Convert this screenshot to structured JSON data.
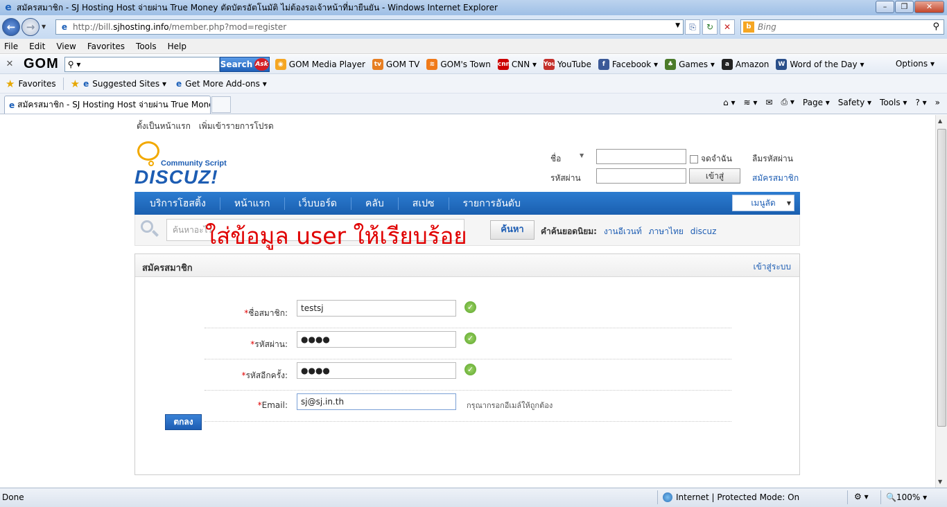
{
  "window": {
    "title": "สมัครสมาชิก - SJ Hosting Host จ่ายผ่าน True Money ตัดบัตรอัตโนมัติ ไม่ต้องรอเจ้าหน้าที่มายืนยัน - Windows Internet Explorer",
    "minimize": "–",
    "maximize": "❐",
    "close": "✕"
  },
  "address": {
    "url_prefix": "http://bill.",
    "url_domain": "sjhosting.info",
    "url_path": "/member.php?mod=register",
    "search_placeholder": "Bing"
  },
  "menu": [
    "File",
    "Edit",
    "View",
    "Favorites",
    "Tools",
    "Help"
  ],
  "gom_toolbar": {
    "logo": "GOM",
    "search_button": "Search",
    "ask_badge": "Ask",
    "links": [
      {
        "label": "GOM Media Player",
        "icon": "gom-player-icon",
        "color": "#f5a623",
        "glyph": "◉"
      },
      {
        "label": "GOM TV",
        "icon": "gomtv-icon",
        "color": "#e67e22",
        "glyph": "tv"
      },
      {
        "label": "GOM's Town",
        "icon": "rss-icon",
        "color": "#f07a1a",
        "glyph": "≋"
      },
      {
        "label": "CNN ▾",
        "icon": "cnn-icon",
        "color": "#cc0000",
        "glyph": "cnn"
      },
      {
        "label": "YouTube",
        "icon": "youtube-icon",
        "color": "#c4302b",
        "glyph": "You"
      },
      {
        "label": "Facebook ▾",
        "icon": "facebook-icon",
        "color": "#3b5998",
        "glyph": "f"
      },
      {
        "label": "Games ▾",
        "icon": "games-icon",
        "color": "#4a7a2a",
        "glyph": "♣"
      },
      {
        "label": "Amazon",
        "icon": "amazon-icon",
        "color": "#222222",
        "glyph": "a"
      },
      {
        "label": "Word of the Day ▾",
        "icon": "dictionary-icon",
        "color": "#2a4f8a",
        "glyph": "W"
      }
    ],
    "options": "Options ▾"
  },
  "favorites_bar": {
    "favorites": "Favorites",
    "suggested": "Suggested Sites ▾",
    "addons": "Get More Add-ons ▾"
  },
  "tab": {
    "title": "สมัครสมาชิก - SJ Hosting Host จ่ายผ่าน True Money..."
  },
  "command_bar": {
    "page": "Page ▾",
    "safety": "Safety ▾",
    "tools": "Tools ▾"
  },
  "site": {
    "top_links": [
      "ตั้งเป็นหน้าแรก",
      "เพิ่มเข้ารายการโปรด"
    ],
    "logo_tagline": "Community Script",
    "logo_name": "DISCUZ!",
    "login": {
      "username_label": "ชื่อ",
      "password_label": "รหัสผ่าน",
      "remember": "จดจำฉัน",
      "submit": "เข้าสู่",
      "forgot": "ลืมรหัสผ่าน",
      "register": "สมัครสมาชิก"
    },
    "nav": [
      "บริการโฮสติ้ง",
      "หน้าแรก",
      "เว็บบอร์ด",
      "คลับ",
      "สเปซ",
      "รายการอันดับ"
    ],
    "quick_menu": "เมนูลัด",
    "search": {
      "placeholder": "ค้นหาอะไร",
      "button": "ค้นหา",
      "hot_label": "คำค้นยอดนิยม:",
      "hot_keywords": [
        "งานอีเวนท์",
        "ภาษาไทย",
        "discuz"
      ]
    },
    "annotation": "ใส่ข้อมูล   user ให้เรียบร้อย",
    "panel": {
      "title": "สมัครสมาชิก",
      "login_link": "เข้าสู่ระบบ",
      "fields": [
        {
          "label": "ชื่อสมาชิก:",
          "value": "testsj",
          "status": "ok"
        },
        {
          "label": "รหัสผ่าน:",
          "value": "●●●●",
          "status": "ok"
        },
        {
          "label": "รหัสอีกครั้ง:",
          "value": "●●●●",
          "status": "ok"
        },
        {
          "label": "Email:",
          "value": "sj@sj.in.th",
          "status": "hint",
          "hint": "กรุณากรอกอีเมล์ให้ถูกต้อง"
        }
      ],
      "required_mark": "*",
      "submit": "ตกลง"
    }
  },
  "status_bar": {
    "status": "Done",
    "zone": "Internet | Protected Mode: On",
    "zoom": "🔍100% ▾"
  }
}
